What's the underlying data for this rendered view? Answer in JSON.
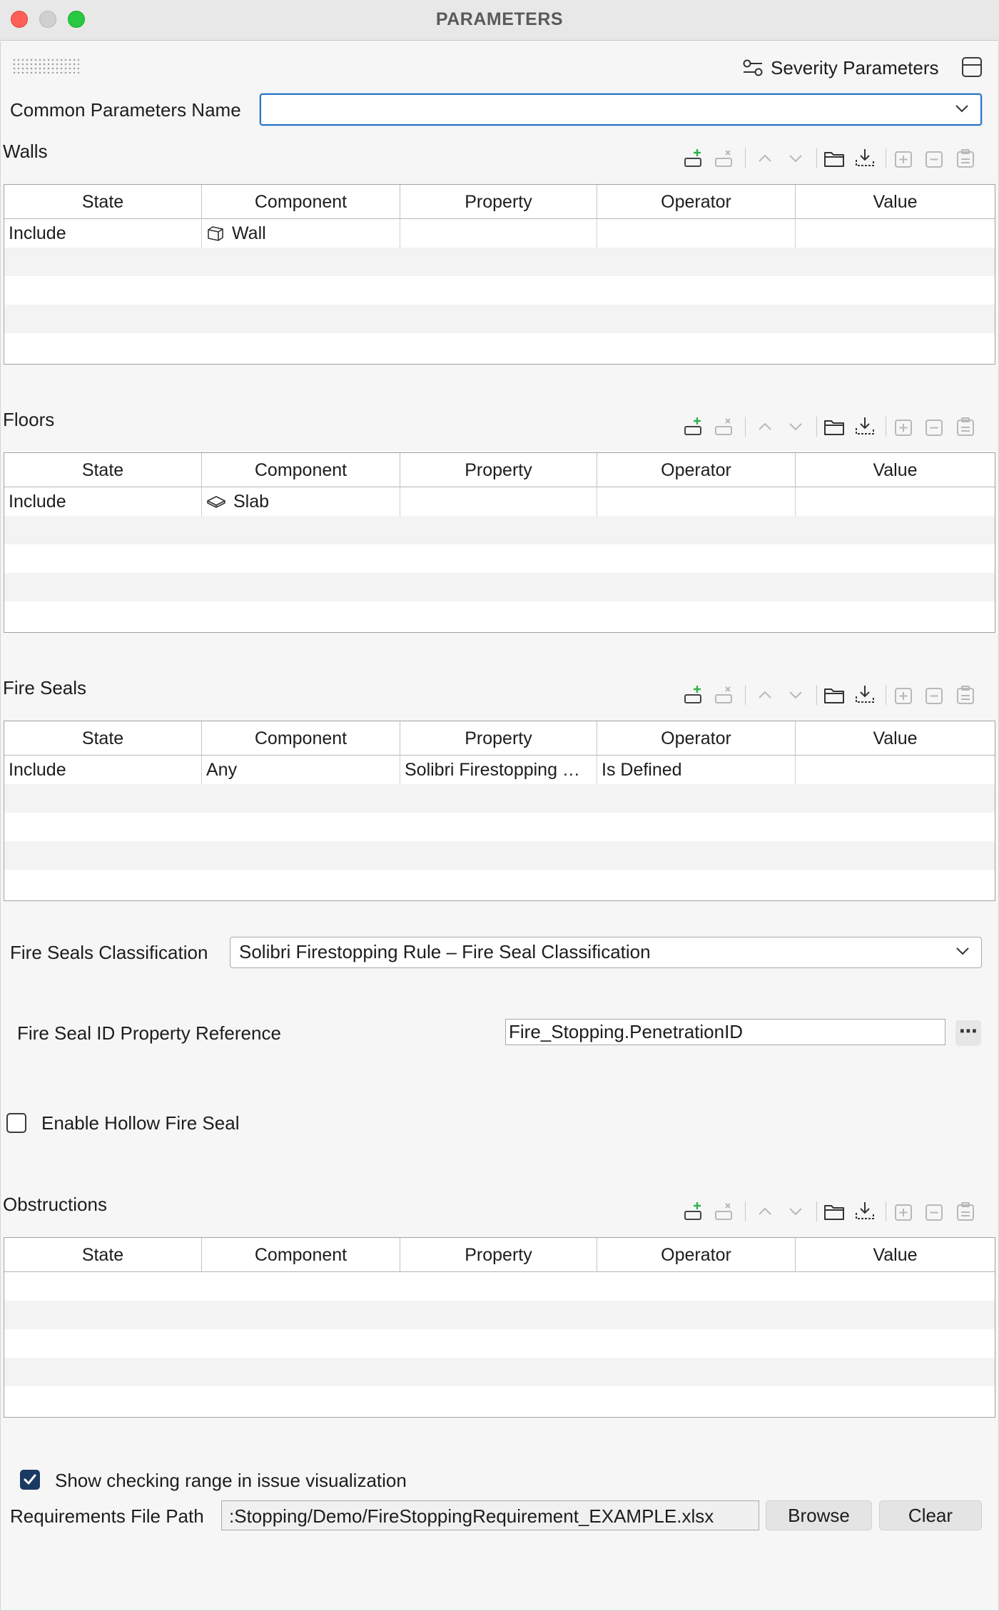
{
  "window": {
    "title": "PARAMETERS"
  },
  "header": {
    "severity_label": "Severity Parameters"
  },
  "common_params": {
    "label": "Common Parameters Name",
    "value": ""
  },
  "columns": [
    "State",
    "Component",
    "Property",
    "Operator",
    "Value"
  ],
  "walls": {
    "title": "Walls",
    "rows": [
      {
        "state": "Include",
        "component": "Wall",
        "component_icon": "wall-icon",
        "property": "",
        "operator": "",
        "value": ""
      }
    ]
  },
  "floors": {
    "title": "Floors",
    "rows": [
      {
        "state": "Include",
        "component": "Slab",
        "component_icon": "slab-icon",
        "property": "",
        "operator": "",
        "value": ""
      }
    ]
  },
  "fire_seals": {
    "title": "Fire Seals",
    "rows": [
      {
        "state": "Include",
        "component": "Any",
        "property": "Solibri Firestopping …",
        "operator": "Is Defined",
        "value": ""
      }
    ]
  },
  "classification": {
    "label": "Fire Seals Classification",
    "value": "Solibri Firestopping Rule – Fire Seal Classification"
  },
  "seal_id": {
    "label": "Fire Seal ID Property Reference",
    "value": "Fire_Stopping.PenetrationID",
    "browse_label": "⋯"
  },
  "hollow": {
    "label": "Enable Hollow Fire Seal",
    "checked": false
  },
  "obstructions": {
    "title": "Obstructions",
    "rows": []
  },
  "checking_range": {
    "label": "Show checking range in issue visualization",
    "checked": true
  },
  "requirements": {
    "label": "Requirements File Path",
    "value": ":Stopping/Demo/FireStoppingRequirement_EXAMPLE.xlsx",
    "browse": "Browse",
    "clear": "Clear"
  },
  "toolbar_icons": [
    "add-row-icon",
    "remove-row-icon",
    "move-up-icon",
    "move-down-icon",
    "open-folder-icon",
    "import-icon",
    "add-group-icon",
    "remove-group-icon",
    "clipboard-icon"
  ],
  "colors": {
    "accent": "#2a74c5",
    "add_green": "#2bb24c",
    "checkbox_checked": "#1b3a63"
  }
}
